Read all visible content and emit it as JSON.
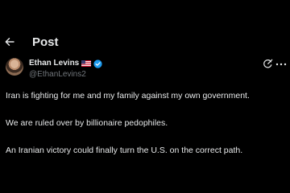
{
  "header": {
    "title": "Post"
  },
  "author": {
    "display_name": "Ethan Levins",
    "handle": "@EthanLevins2",
    "flag": "us-flag-emoji",
    "verified": true
  },
  "actions": {
    "grok_icon": "grok-icon",
    "more_icon": "more-icon"
  },
  "tweet": {
    "paragraphs": [
      "Iran is fighting for me and my family against my own government.",
      "We are ruled over by billionaire pedophiles.",
      "An Iranian victory could finally turn the U.S. on the correct path."
    ]
  },
  "colors": {
    "background": "#000000",
    "text": "#e7e9ea",
    "muted": "#71767b",
    "verified": "#1d9bf0"
  }
}
